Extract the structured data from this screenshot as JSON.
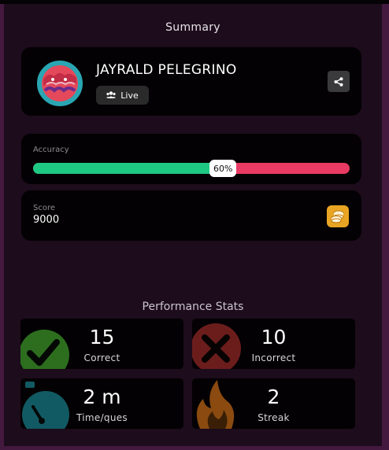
{
  "summary": {
    "title": "Summary"
  },
  "player": {
    "name": "JAYRALD PELEGRINO",
    "status": "Live",
    "avatar_icon": "monster-avatar-icon",
    "share_icon": "share-icon"
  },
  "accuracy": {
    "label": "Accuracy",
    "percent": 60,
    "percent_text": "60%",
    "correct_color": "#1ec983",
    "incorrect_color": "#e93a63"
  },
  "score": {
    "label": "Score",
    "value": "9000",
    "icon": "coins-icon"
  },
  "performance": {
    "title": "Performance Stats",
    "stats": [
      {
        "value": "15",
        "label": "Correct",
        "icon": "checkmark-icon",
        "color": "#2c6e1e"
      },
      {
        "value": "10",
        "label": "Incorrect",
        "icon": "cross-icon",
        "color": "#6b1d1c"
      },
      {
        "value": "2 m",
        "label": "Time/ques",
        "icon": "stopwatch-icon",
        "color": "#125a63"
      },
      {
        "value": "2",
        "label": "Streak",
        "icon": "flame-icon",
        "color": "#8a4a10"
      }
    ]
  }
}
